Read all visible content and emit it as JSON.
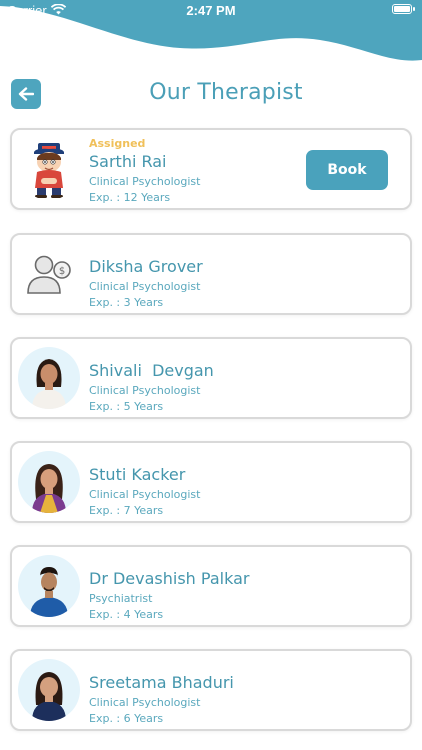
{
  "status_bar": {
    "carrier": "Carrier",
    "time": "2:47 PM"
  },
  "header": {
    "title": "Our Therapist",
    "back_icon": "arrow-left-icon"
  },
  "colors": {
    "accent": "#4ea5be",
    "assigned": "#f0c05a"
  },
  "therapists": [
    {
      "badge": "Assigned",
      "name": "Sarthi Rai",
      "role": "Clinical Psychologist",
      "experience": "Exp. : 12 Years",
      "action": "Book"
    },
    {
      "name": "Diksha Grover",
      "role": "Clinical Psychologist",
      "experience": "Exp. : 3 Years"
    },
    {
      "name": "Shivali  Devgan",
      "role": "Clinical Psychologist",
      "experience": "Exp. : 5 Years"
    },
    {
      "name": "Stuti Kacker",
      "role": "Clinical Psychologist",
      "experience": "Exp. : 7 Years"
    },
    {
      "name": "Dr Devashish Palkar",
      "role": "Psychiatrist",
      "experience": "Exp. : 4 Years"
    },
    {
      "name": "Sreetama Bhaduri",
      "role": "Clinical Psychologist",
      "experience": "Exp. : 6 Years"
    }
  ]
}
